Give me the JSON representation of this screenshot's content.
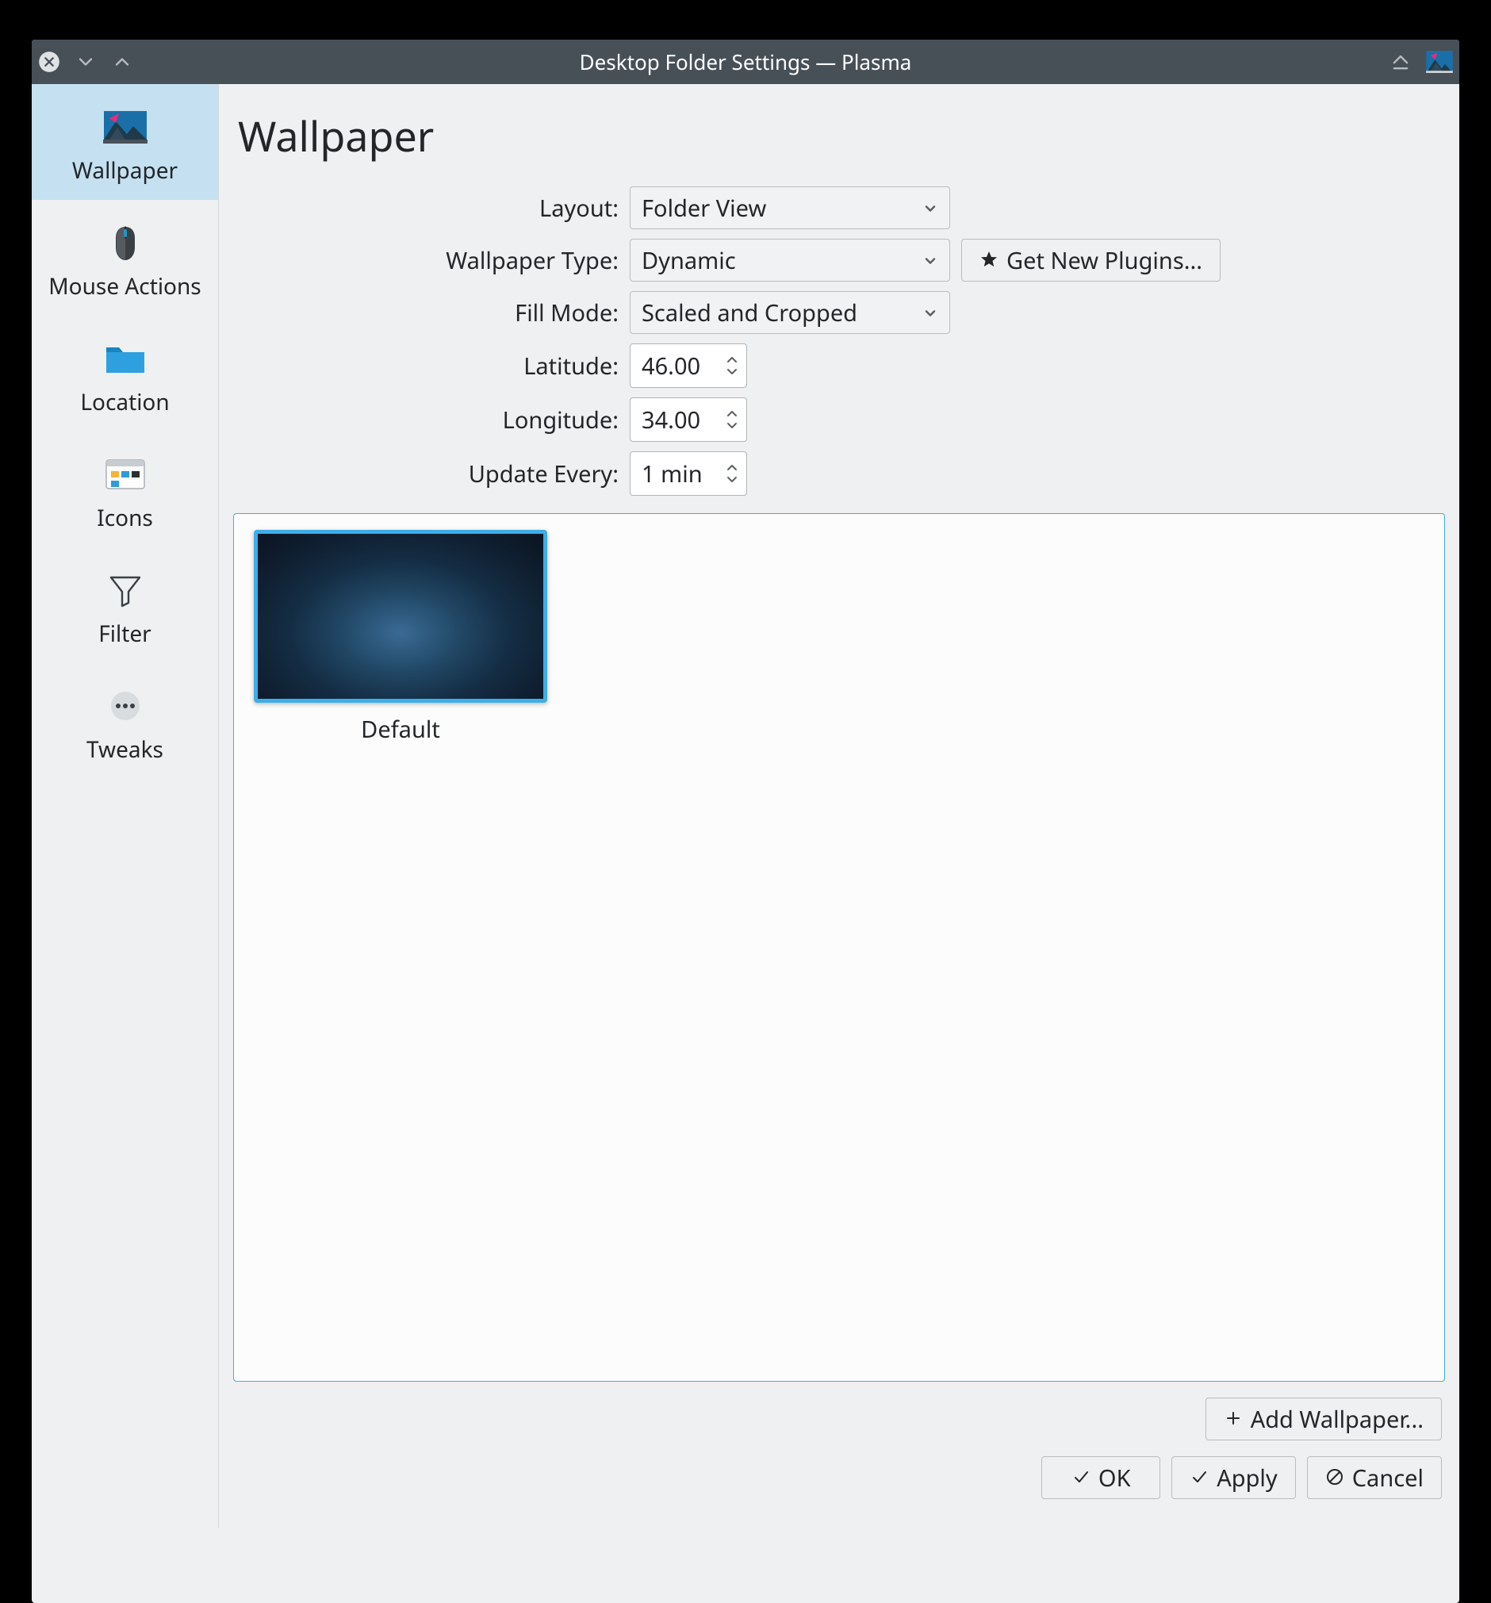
{
  "window": {
    "title": "Desktop Folder Settings — Plasma"
  },
  "sidebar": {
    "items": [
      {
        "label": "Wallpaper"
      },
      {
        "label": "Mouse Actions"
      },
      {
        "label": "Location"
      },
      {
        "label": "Icons"
      },
      {
        "label": "Filter"
      },
      {
        "label": "Tweaks"
      }
    ]
  },
  "page": {
    "title": "Wallpaper"
  },
  "form": {
    "layout_label": "Layout:",
    "layout_value": "Folder View",
    "wallpaper_type_label": "Wallpaper Type:",
    "wallpaper_type_value": "Dynamic",
    "get_plugins": "Get New Plugins...",
    "fill_mode_label": "Fill Mode:",
    "fill_mode_value": "Scaled and Cropped",
    "latitude_label": "Latitude:",
    "latitude_value": "46.00",
    "longitude_label": "Longitude:",
    "longitude_value": "34.00",
    "update_label": "Update Every:",
    "update_value": "1 min"
  },
  "gallery": {
    "items": [
      {
        "label": "Default"
      }
    ]
  },
  "buttons": {
    "add_wallpaper": "Add Wallpaper...",
    "ok": "OK",
    "apply": "Apply",
    "cancel": "Cancel"
  }
}
